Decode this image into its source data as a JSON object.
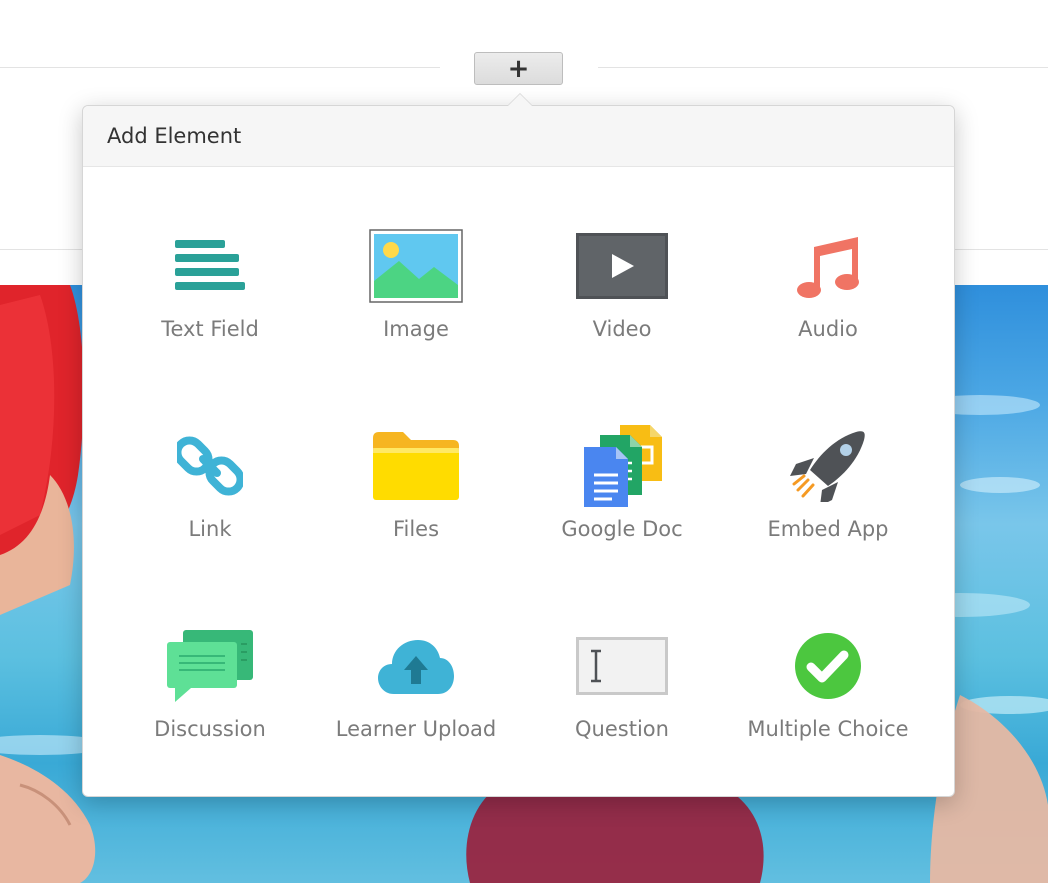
{
  "toolbar": {
    "add_button_label": "+"
  },
  "popover": {
    "title": "Add Element",
    "items": [
      {
        "label": "Text Field",
        "icon": "text-field-icon"
      },
      {
        "label": "Image",
        "icon": "image-icon"
      },
      {
        "label": "Video",
        "icon": "video-icon"
      },
      {
        "label": "Audio",
        "icon": "audio-icon"
      },
      {
        "label": "Link",
        "icon": "link-icon"
      },
      {
        "label": "Files",
        "icon": "folder-icon"
      },
      {
        "label": "Google Doc",
        "icon": "google-doc-icon"
      },
      {
        "label": "Embed App",
        "icon": "rocket-icon"
      },
      {
        "label": "Discussion",
        "icon": "discussion-icon"
      },
      {
        "label": "Learner Upload",
        "icon": "cloud-upload-icon"
      },
      {
        "label": "Question",
        "icon": "question-input-icon"
      },
      {
        "label": "Multiple Choice",
        "icon": "checkmark-icon"
      }
    ]
  },
  "colors": {
    "teal": "#2aa198",
    "coral": "#f07464",
    "sky": "#3fb3d6",
    "yellow": "#ffd200",
    "green": "#4fd38a",
    "check_green": "#4cc73f",
    "dark_gray": "#4f5256"
  }
}
